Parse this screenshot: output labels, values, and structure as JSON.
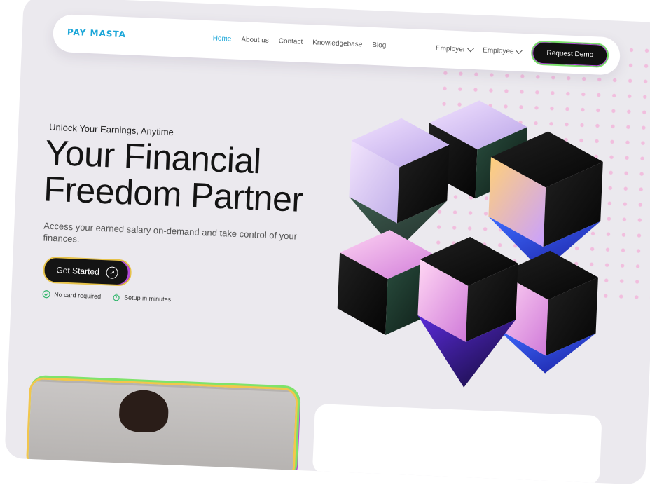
{
  "nav": {
    "logo": "PAY MASTA",
    "links": [
      "Home",
      "About us",
      "Contact",
      "Knowledgebase",
      "Blog"
    ],
    "dropdowns": [
      "Employer",
      "Employee"
    ],
    "cta": "Request Demo"
  },
  "hero": {
    "tagline": "Unlock Your Earnings, Anytime",
    "headline_line1": "Your Financial",
    "headline_line2": "Freedom Partner",
    "subtext": "Access your earned salary on-demand and take control of your finances.",
    "cta": "Get Started",
    "features": [
      "No card required",
      "Setup in minutes"
    ]
  },
  "icons": {
    "cta": "arrow-up-right-icon",
    "feature1": "check-circle-icon",
    "feature2": "stopwatch-icon",
    "dropdown": "chevron-down-icon"
  },
  "colors": {
    "brand": "#1ba6d8",
    "background": "#ebe9ee",
    "dark": "#141414",
    "accent_green": "#7be06d",
    "accent_purple": "#b34bd9",
    "accent_yellow": "#e6c24a",
    "dots": "#f2b9dc"
  }
}
